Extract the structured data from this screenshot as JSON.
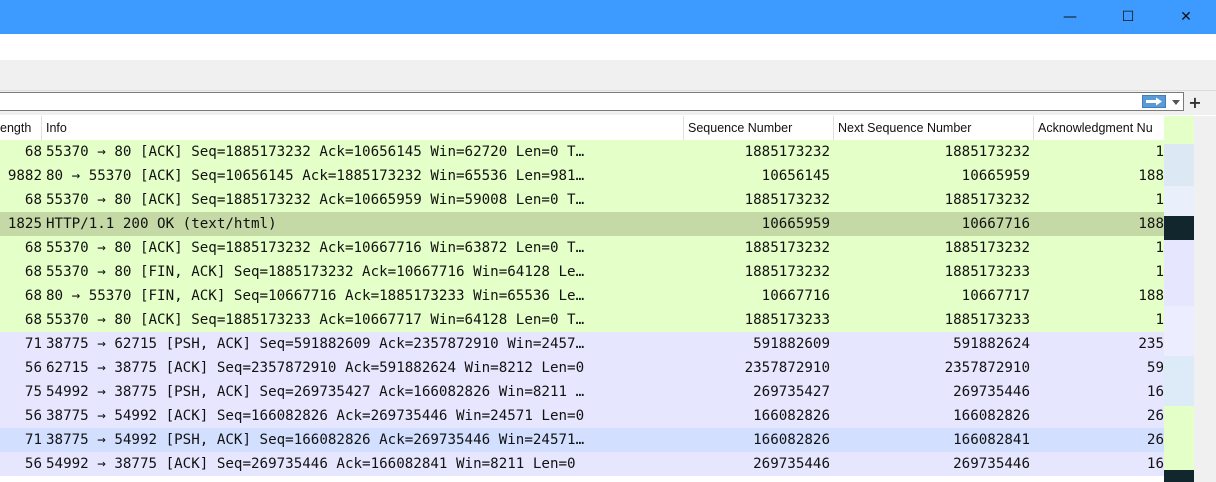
{
  "window": {
    "minimize_glyph": "—",
    "maximize_glyph": "☐",
    "close_glyph": "✕"
  },
  "filter": {
    "value": "",
    "add_glyph": "+"
  },
  "colors": {
    "title_bar": "#3d9bff",
    "tcp_green": "#e4ffc7",
    "http_selected": "#c4d9a5",
    "tcp_lavender": "#e7e6ff",
    "selected_blue": "#d2dfff"
  },
  "columns": [
    {
      "label": "ength"
    },
    {
      "label": "Info"
    },
    {
      "label": "Sequence Number"
    },
    {
      "label": "Next Sequence Number"
    },
    {
      "label": "Acknowledgment Nu"
    }
  ],
  "rows": [
    {
      "length": "68",
      "info": "55370 → 80 [ACK] Seq=1885173232 Ack=10656145 Win=62720 Len=0 T…",
      "seq": "1885173232",
      "next_seq": "1885173232",
      "ack": "1",
      "color": "#e4ffc7"
    },
    {
      "length": "9882",
      "info": "80 → 55370 [ACK] Seq=10656145 Ack=1885173232 Win=65536 Len=981…",
      "seq": "10656145",
      "next_seq": "10665959",
      "ack": "188",
      "color": "#e4ffc7"
    },
    {
      "length": "68",
      "info": "55370 → 80 [ACK] Seq=1885173232 Ack=10665959 Win=59008 Len=0 T…",
      "seq": "1885173232",
      "next_seq": "1885173232",
      "ack": "1",
      "color": "#e4ffc7"
    },
    {
      "length": "1825",
      "info": "HTTP/1.1 200 OK  (text/html)",
      "seq": "10665959",
      "next_seq": "10667716",
      "ack": "188",
      "color": "#c4d9a5"
    },
    {
      "length": "68",
      "info": "55370 → 80 [ACK] Seq=1885173232 Ack=10667716 Win=63872 Len=0 T…",
      "seq": "1885173232",
      "next_seq": "1885173232",
      "ack": "1",
      "color": "#e4ffc7"
    },
    {
      "length": "68",
      "info": "55370 → 80 [FIN, ACK] Seq=1885173232 Ack=10667716 Win=64128 Le…",
      "seq": "1885173232",
      "next_seq": "1885173233",
      "ack": "1",
      "color": "#e4ffc7"
    },
    {
      "length": "68",
      "info": "80 → 55370 [FIN, ACK] Seq=10667716 Ack=1885173233 Win=65536 Le…",
      "seq": "10667716",
      "next_seq": "10667717",
      "ack": "188",
      "color": "#e4ffc7"
    },
    {
      "length": "68",
      "info": "55370 → 80 [ACK] Seq=1885173233 Ack=10667717 Win=64128 Len=0 T…",
      "seq": "1885173233",
      "next_seq": "1885173233",
      "ack": "1",
      "color": "#e4ffc7"
    },
    {
      "length": "71",
      "info": "38775 → 62715 [PSH, ACK] Seq=591882609 Ack=2357872910 Win=2457…",
      "seq": "591882609",
      "next_seq": "591882624",
      "ack": "235",
      "color": "#e7e6ff"
    },
    {
      "length": "56",
      "info": "62715 → 38775 [ACK] Seq=2357872910 Ack=591882624 Win=8212 Len=0",
      "seq": "2357872910",
      "next_seq": "2357872910",
      "ack": "59",
      "color": "#e7e6ff"
    },
    {
      "length": "75",
      "info": "54992 → 38775 [PSH, ACK] Seq=269735427 Ack=166082826 Win=8211 …",
      "seq": "269735427",
      "next_seq": "269735446",
      "ack": "16",
      "color": "#e7e6ff"
    },
    {
      "length": "56",
      "info": "38775 → 54992 [ACK] Seq=166082826 Ack=269735446 Win=24571 Len=0",
      "seq": "166082826",
      "next_seq": "166082826",
      "ack": "26",
      "color": "#e7e6ff"
    },
    {
      "length": "71",
      "info": "38775 → 54992 [PSH, ACK] Seq=166082826 Ack=269735446 Win=24571…",
      "seq": "166082826",
      "next_seq": "166082841",
      "ack": "26",
      "color": "#d2dfff"
    },
    {
      "length": "56",
      "info": "54992 → 38775 [ACK] Seq=269735446 Ack=166082841 Win=8211 Len=0",
      "seq": "269735446",
      "next_seq": "269735446",
      "ack": "16",
      "color": "#e7e6ff"
    }
  ]
}
